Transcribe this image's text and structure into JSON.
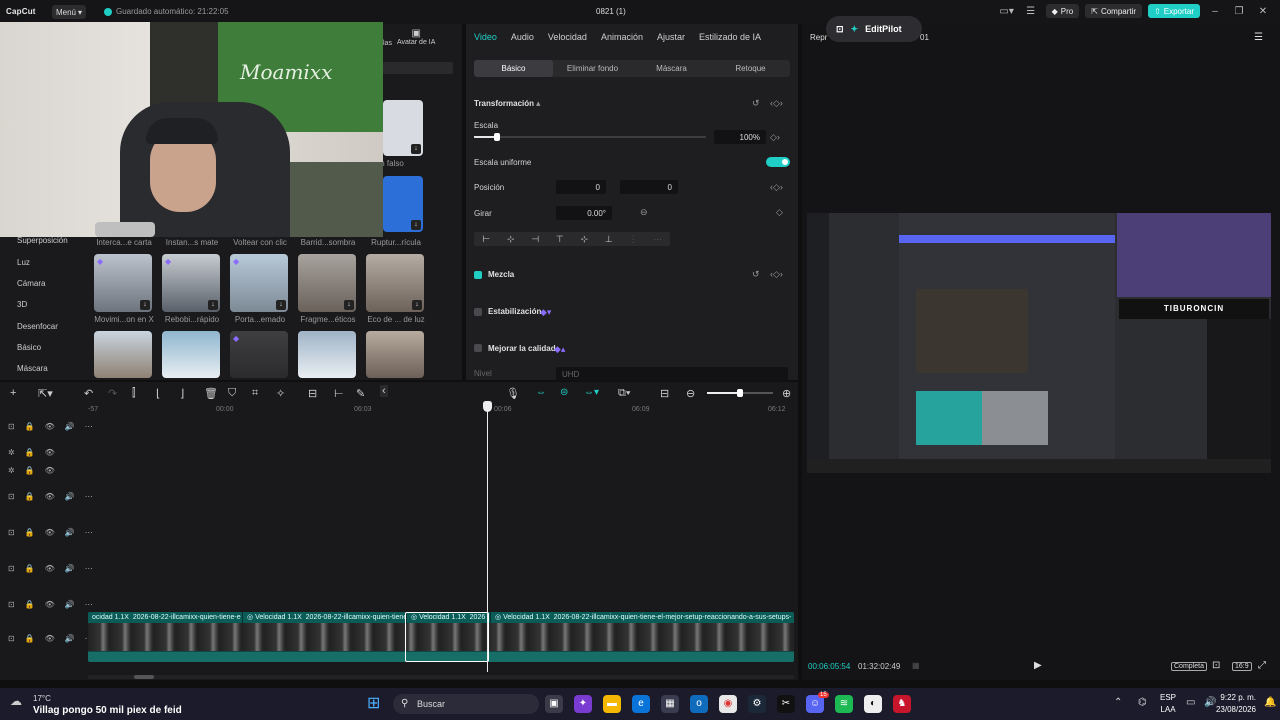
{
  "app": {
    "logo": "CapCut",
    "menu_label": "Menú",
    "autosave": "Guardado automático: 21:22:05",
    "project_title": "0821 (1)",
    "pro_label": "Pro",
    "share_label": "Compartir",
    "export_label": "Exportar"
  },
  "media": {
    "tab_ias": "las",
    "tab_avatar": "Avatar de IA",
    "categories": [
      "Superposición",
      "Luz",
      "Cámara",
      "3D",
      "Desenfocar",
      "Básico",
      "Máscara"
    ],
    "row0_titles": [
      "m falso"
    ],
    "row1_titles": [
      "Interca...e carta",
      "Instan...s mate",
      "Voltear con clic",
      "Barrid...sombra",
      "Ruptur...rícula"
    ],
    "row2_titles": [
      "Movimi...on en X",
      "Rebobi...rápido",
      "Porta...emado",
      "Fragme...éticos",
      "Eco de ... de luz"
    ]
  },
  "inspector": {
    "tabs": [
      "Video",
      "Audio",
      "Velocidad",
      "Animación",
      "Ajustar",
      "Estilizado de IA"
    ],
    "subtabs": [
      "Básico",
      "Eliminar fondo",
      "Máscara",
      "Retoque"
    ],
    "transform_label": "Transformación",
    "scale_label": "Escala",
    "scale_value": "100%",
    "scale_fraction": 0.1,
    "uniform_label": "Escala uniforme",
    "position_label": "Posición",
    "pos_x_label": "X",
    "pos_x_value": "0",
    "pos_y_label": "Y",
    "pos_y_value": "0",
    "rotate_label": "Girar",
    "rotate_value": "0.00°",
    "blend_label": "Mezcla",
    "stabilize_label": "Estabilización",
    "quality_label": "Mejorar la calidad",
    "level_label": "Nivel",
    "level_value": "UHD"
  },
  "player": {
    "editpilot": "EditPilot",
    "header_left": "Repr",
    "header_right": "01",
    "timecode": "00:06:05:54",
    "duration": "01:32:02:49",
    "complete_label": "Completa",
    "ratio_label": "16:9",
    "sponsor_text": "TIBURONCIN"
  },
  "timeline": {
    "ruler_ticks": [
      "-57",
      "00:00",
      "06:03",
      "00:06",
      "06:09",
      "06:12"
    ],
    "clips": [
      {
        "speed": "ocidad 1.1X",
        "name": "2026-08-22-illcamixx-quien-tiene-e"
      },
      {
        "speed": "Velocidad 1.1X",
        "name": "2026-08-22-illcamixx-quien-tiene"
      },
      {
        "speed": "Velocidad 1.1X",
        "name": "2026"
      },
      {
        "speed": "Velocidad 1.1X",
        "name": "2026-08-22-illcamixx-quien-tiene-el-mejor-setup-reaccionando-a-sus-setups-"
      }
    ]
  },
  "taskbar": {
    "temperature": "17°C",
    "overlay": "Villag pongo 50 mil piex de feid",
    "search_placeholder": "Buscar",
    "lang_top": "ESP",
    "lang_bottom": "LAA",
    "time": "9:22 p. m.",
    "date": "23/08/2026",
    "discord_badge": "15"
  },
  "colors": {
    "accent": "#1fcfc6",
    "background": "#0f0f10",
    "panel": "#1e1e20",
    "clip": "#0f4a48"
  }
}
